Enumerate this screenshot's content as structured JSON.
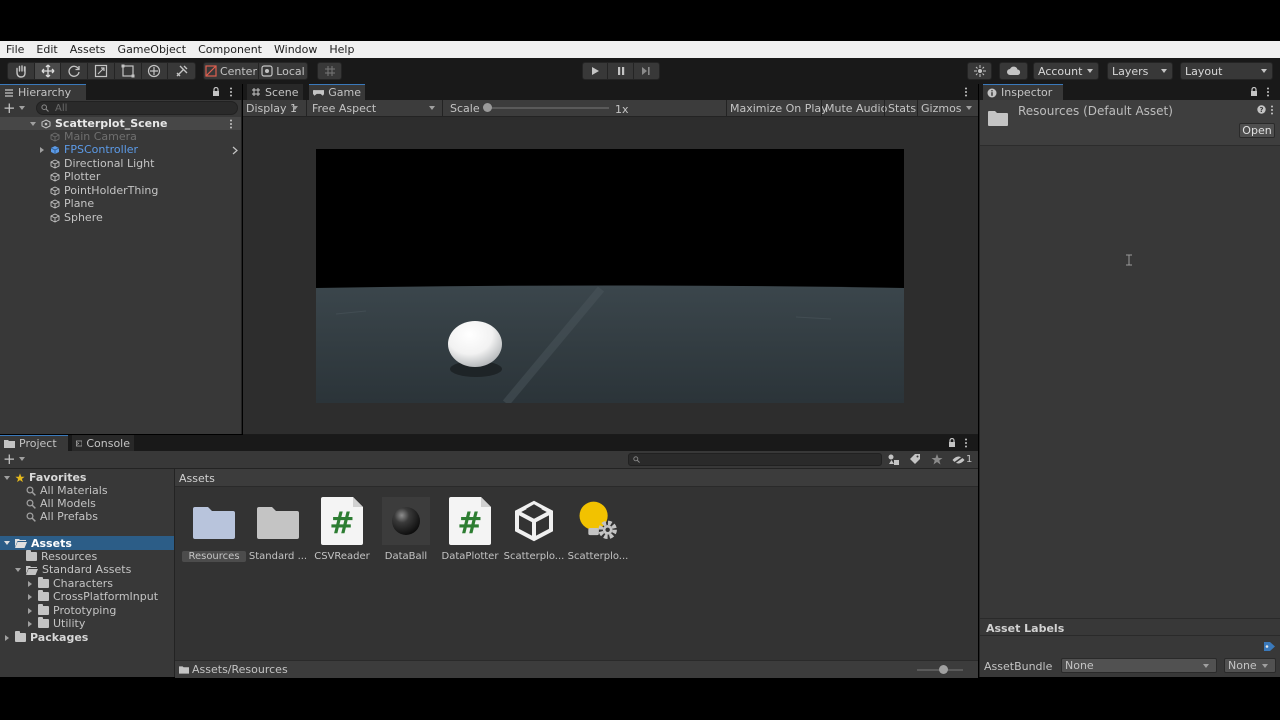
{
  "menu": [
    "File",
    "Edit",
    "Assets",
    "GameObject",
    "Component",
    "Window",
    "Help"
  ],
  "toolbar": {
    "pivot_label": "Center",
    "space_label": "Local",
    "account_label": "Account",
    "layers_label": "Layers",
    "layout_label": "Layout"
  },
  "hierarchy": {
    "tab": "Hierarchy",
    "search_placeholder": "All",
    "scene": "Scatterplot_Scene",
    "items": [
      "Main Camera",
      "FPSController",
      "Directional Light",
      "Plotter",
      "PointHolderThing",
      "Plane",
      "Sphere"
    ]
  },
  "game_view": {
    "tabs": [
      "Scene",
      "Game"
    ],
    "display": "Display 1",
    "aspect": "Free Aspect",
    "scale_label": "Scale",
    "scale_value": "1x",
    "scale_fraction": 0.0,
    "buttons": [
      "Maximize On Play",
      "Mute Audio",
      "Stats",
      "Gizmos"
    ]
  },
  "inspector": {
    "tab": "Inspector",
    "asset_title": "Resources (Default Asset)",
    "open_button": "Open",
    "asset_labels": "Asset Labels",
    "assetbundle_label": "AssetBundle",
    "assetbundle_value": "None",
    "variant_value": "None"
  },
  "project": {
    "tabs": [
      "Project",
      "Console"
    ],
    "hidden_count": "1",
    "favorites_label": "Favorites",
    "favorites": [
      "All Materials",
      "All Models",
      "All Prefabs"
    ],
    "assets_label": "Assets",
    "tree": {
      "resources": "Resources",
      "standard_assets": "Standard Assets",
      "children": [
        "Characters",
        "CrossPlatformInput",
        "Prototyping",
        "Utility"
      ],
      "packages": "Packages"
    },
    "grid_header": "Assets",
    "grid_items": [
      {
        "label": "Resources",
        "icon": "folder-icon"
      },
      {
        "label": "Standard ...",
        "icon": "folder-icon"
      },
      {
        "label": "CSVReader",
        "icon": "csharp-script-icon"
      },
      {
        "label": "DataBall",
        "icon": "material-sphere-icon"
      },
      {
        "label": "DataPlotter",
        "icon": "csharp-script-icon"
      },
      {
        "label": "Scatterplo...",
        "icon": "unity-scene-icon"
      },
      {
        "label": "Scatterplo...",
        "icon": "lighting-settings-icon"
      }
    ],
    "path": "Assets/Resources"
  },
  "colors": {
    "accent": "#3a79bb",
    "panel": "#383838",
    "header": "#191919",
    "script_green": "#2d7d32",
    "light_yellow": "#f2c200"
  }
}
